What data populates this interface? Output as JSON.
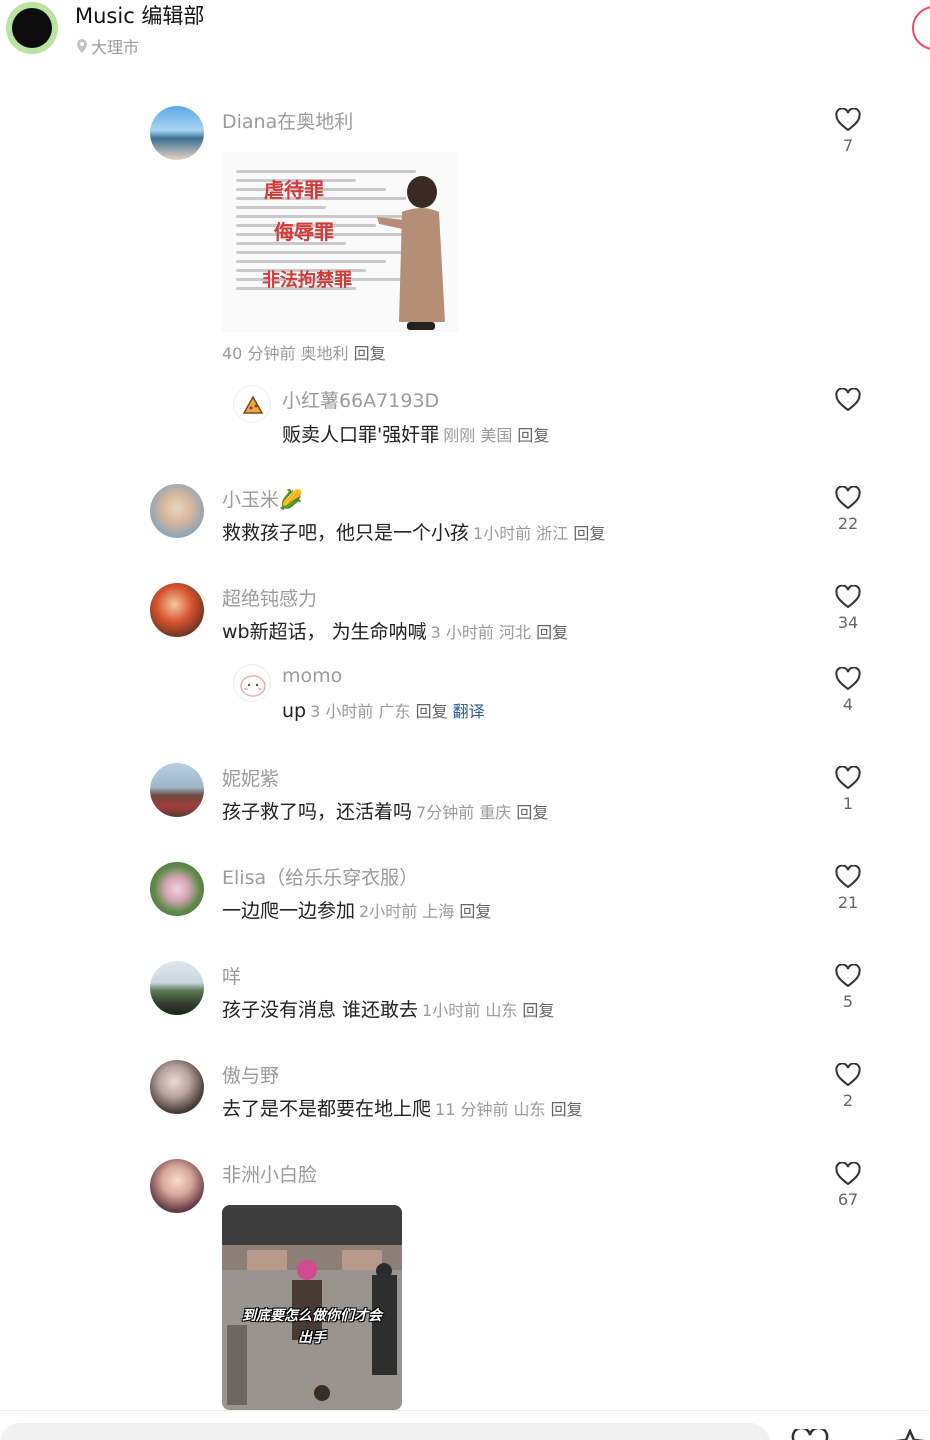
{
  "header": {
    "title": "Music 编辑部",
    "location": "大理市"
  },
  "comments": [
    {
      "name": "Diana在奥地利",
      "image": {
        "overlay_lines": [
          "虐待罪",
          "侮辱罪",
          "非法拘禁罪"
        ]
      },
      "meta": "40 分钟前  奥地利",
      "reply_label": "回复",
      "likes": "7"
    },
    {
      "name": "小红薯66A7193D",
      "text": "贩卖人口罪'强奸罪",
      "meta": "刚刚  美国",
      "reply_label": "回复",
      "likes": ""
    },
    {
      "name": "小玉米🌽",
      "text": "救救孩子吧，他只是一个小孩",
      "meta": "1小时前  浙江",
      "reply_label": "回复",
      "likes": "22"
    },
    {
      "name": "超绝钝感力",
      "text": "wb新超话，  为生命呐喊",
      "meta": "3 小时前  河北",
      "reply_label": "回复",
      "likes": "34"
    },
    {
      "name": "momo",
      "text": "up",
      "meta": "3 小时前  广东",
      "reply_label": "回复",
      "translate_label": "翻译",
      "likes": "4"
    },
    {
      "name": "妮妮紫",
      "text": "孩子救了吗，还活着吗",
      "meta": "7分钟前  重庆",
      "reply_label": "回复",
      "likes": "1"
    },
    {
      "name": "Elisa（给乐乐穿衣服）",
      "text": "一边爬一边参加",
      "meta": "2小时前  上海",
      "reply_label": "回复",
      "likes": "21"
    },
    {
      "name": "咩",
      "text": "孩子没有消息 谁还敢去",
      "meta": "1小时前  山东",
      "reply_label": "回复",
      "likes": "5"
    },
    {
      "name": "傲与野",
      "text": "去了是不是都要在地上爬",
      "meta": "11 分钟前  山东",
      "reply_label": "回复",
      "likes": "2"
    },
    {
      "name": "非洲小白脸",
      "image": {
        "caption_line1": "到底要怎么做你们才会",
        "caption_line2": "出手"
      },
      "likes": "67"
    }
  ],
  "colors": {
    "accent": "#f0485d",
    "link": "#2b5c9e",
    "muted": "#9b9b9b"
  }
}
